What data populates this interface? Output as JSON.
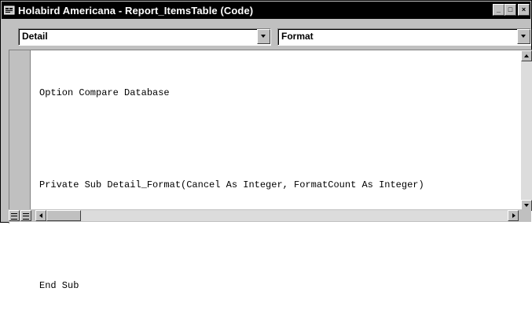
{
  "window": {
    "title": "Holabird Americana - Report_ItemsTable (Code)"
  },
  "title_buttons": {
    "minimize": "_",
    "maximize": "□",
    "close": "×"
  },
  "object_combo": {
    "value": "Detail"
  },
  "procedure_combo": {
    "value": "Format"
  },
  "code": {
    "lines": [
      "Option Compare Database",
      "Private Sub Detail_Format(Cancel As Integer, FormatCount As Integer)",
      "End Sub"
    ]
  },
  "icons": {
    "app": "code-window-icon",
    "minimize": "minimize-icon",
    "maximize": "maximize-icon",
    "close": "close-icon"
  },
  "colors": {
    "titlebar": "#000000",
    "chrome": "#c0c0c0",
    "code_bg": "#ffffff"
  }
}
